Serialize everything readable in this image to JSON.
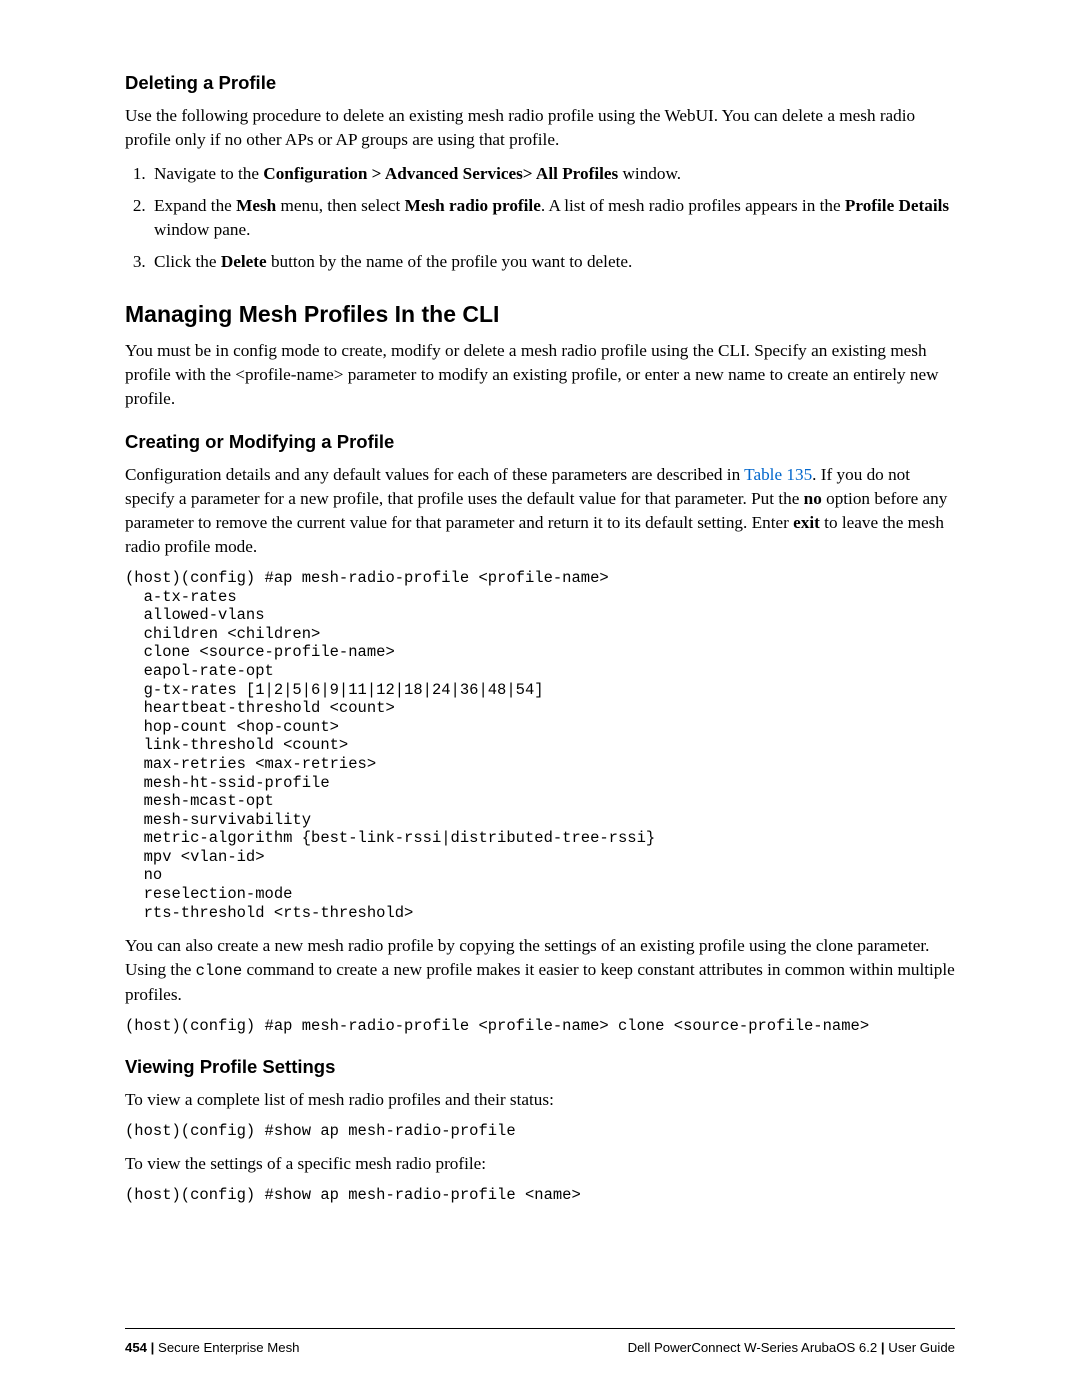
{
  "s1": {
    "title": "Deleting a Profile",
    "p1a": "Use the following procedure to delete an existing mesh radio profile using the WebUI. You can delete a mesh radio profile only if no other APs or AP groups are using that profile.",
    "li1_a": "Navigate to the ",
    "li1_b": "Configuration > Advanced Services> All Profiles",
    "li1_c": " window.",
    "li2_a": "Expand the ",
    "li2_b": "Mesh",
    "li2_c": " menu, then select ",
    "li2_d": "Mesh radio profile",
    "li2_e": ". A list of mesh radio profiles appears in the ",
    "li2_f": "Profile Details",
    "li2_g": " window pane.",
    "li3_a": "Click the ",
    "li3_b": "Delete",
    "li3_c": " button by the name of the profile you want to delete."
  },
  "s2": {
    "title": "Managing Mesh Profiles In the CLI",
    "p1": "You must be in config mode to create, modify or delete a mesh radio profile using the CLI. Specify an existing mesh profile with the <profile-name> parameter to modify an existing profile, or enter a new name to create an entirely new profile."
  },
  "s3": {
    "title": "Creating or Modifying a Profile",
    "p1_a": "Configuration details and any default values for each of these parameters are described in ",
    "p1_link": "Table 135",
    "p1_b": ". If you do not specify a parameter for a new profile, that profile uses the default value for that parameter. Put the ",
    "p1_c": "no",
    "p1_d": " option before any parameter to remove the current value for that parameter and return it to its default setting. Enter ",
    "p1_e": "exit",
    "p1_f": " to leave the mesh radio profile mode.",
    "code1": "(host)(config) #ap mesh-radio-profile <profile-name>\n  a-tx-rates\n  allowed-vlans\n  children <children>\n  clone <source-profile-name>\n  eapol-rate-opt\n  g-tx-rates [1|2|5|6|9|11|12|18|24|36|48|54]\n  heartbeat-threshold <count>\n  hop-count <hop-count>\n  link-threshold <count>\n  max-retries <max-retries>\n  mesh-ht-ssid-profile\n  mesh-mcast-opt\n  mesh-survivability\n  metric-algorithm {best-link-rssi|distributed-tree-rssi}\n  mpv <vlan-id>\n  no\n  reselection-mode\n  rts-threshold <rts-threshold>",
    "p2_a": "You can also create a new mesh radio profile by copying the settings of an existing profile using the clone parameter. Using the ",
    "p2_b": "clone",
    "p2_c": " command to create a new profile makes it easier to keep constant attributes in common within multiple profiles.",
    "code2": "(host)(config) #ap mesh-radio-profile <profile-name> clone <source-profile-name>"
  },
  "s4": {
    "title": "Viewing Profile Settings",
    "p1": "To view a complete list of mesh radio profiles and their status:",
    "code1": "(host)(config) #show ap mesh-radio-profile",
    "p2": "To view the settings of a specific mesh radio profile:",
    "code2": "(host)(config) #show ap mesh-radio-profile <name>"
  },
  "footer": {
    "page": "454",
    "sep": " | ",
    "left": "Secure Enterprise Mesh",
    "right_a": "Dell PowerConnect W-Series ArubaOS 6.2",
    "right_b": "User Guide"
  }
}
